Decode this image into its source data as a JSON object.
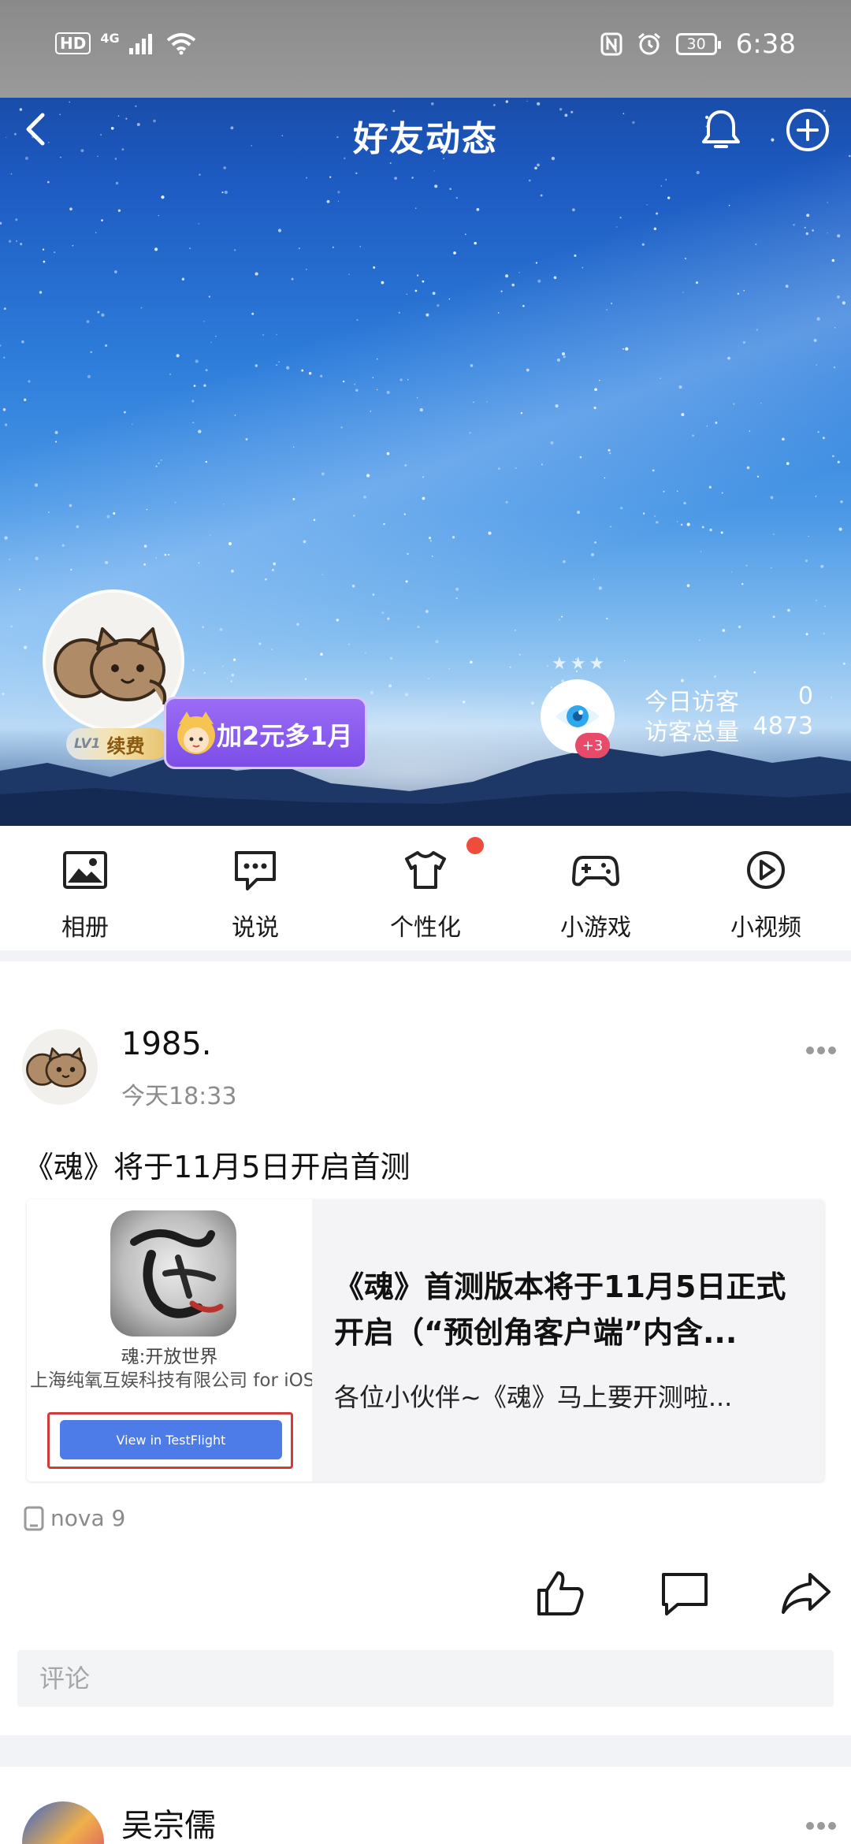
{
  "status_bar": {
    "hd": "HD",
    "network": "4G",
    "battery": "30",
    "time": "6:38"
  },
  "header": {
    "title": "好友动态"
  },
  "profile": {
    "level": "LV1",
    "renew": "续费",
    "promo": "加2元多1月",
    "visitor_badge": "+3",
    "today_visitors_label": "今日访客",
    "today_visitors": "0",
    "total_visitors_label": "访客总量",
    "total_visitors": "4873"
  },
  "shortcuts": [
    {
      "label": "相册",
      "icon": "photo-album-icon"
    },
    {
      "label": "说说",
      "icon": "speech-bubble-icon"
    },
    {
      "label": "个性化",
      "icon": "tshirt-icon"
    },
    {
      "label": "小游戏",
      "icon": "gamepad-icon"
    },
    {
      "label": "小视频",
      "icon": "play-circle-icon"
    }
  ],
  "post": {
    "author": "1985.",
    "time": "今天18:33",
    "text": "《魂》将于11月5日开启首测",
    "card": {
      "app_name": "魂:开放世界",
      "developer": "上海纯氧互娱科技有限公司 for iOS",
      "button": "View in TestFlight",
      "title": "《魂》首测版本将于11月5日正式开启（“预创角客户端”内含...",
      "description": "各位小伙伴~《魂》马上要开测啦..."
    },
    "device": "nova 9",
    "comment_placeholder": "评论"
  },
  "next_post": {
    "author": "吴宗儒"
  },
  "colors": {
    "promo_purple": "#7c4ee8",
    "red_dot": "#ee4d3c",
    "testflight_blue": "#4d7ce8",
    "visitor_badge": "#e84a6a"
  }
}
